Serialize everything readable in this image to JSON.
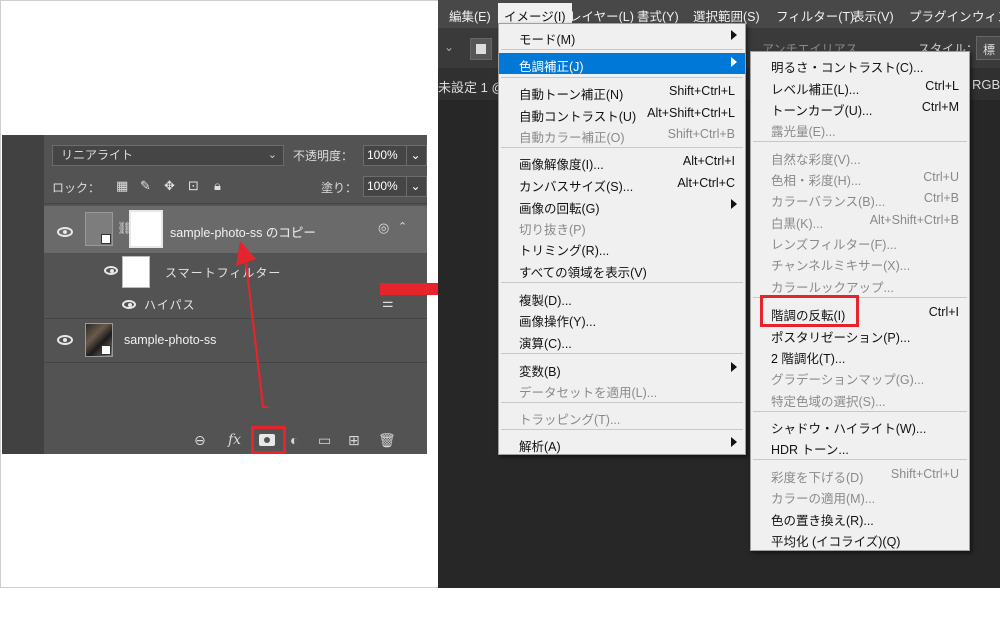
{
  "layers_panel": {
    "blend_mode": "リニアライト",
    "opacity_label": "不透明度：",
    "opacity_value": "100%",
    "lock_label": "ロック：",
    "fill_label": "塗り：",
    "fill_value": "100%",
    "layers": [
      {
        "name": "sample-photo-ss のコピー"
      },
      {
        "name": "スマートフィルター"
      },
      {
        "name": "ハイパス"
      },
      {
        "name": "sample-photo-ss"
      }
    ],
    "bottom_icons": {
      "fx": "fx"
    }
  },
  "menubar": [
    "編集(E)",
    "イメージ(I)",
    "レイヤー(L)",
    "書式(Y)",
    "選択範囲(S)",
    "フィルター(T)",
    "表示(V)",
    "プラグイン",
    "ウィン"
  ],
  "options_bar": {
    "anti_alias": "アンチエイリアス",
    "style": "スタイル：",
    "style_value": "標"
  },
  "doc_tab": "未設定 1 @",
  "doc_tab_right": "RGB/",
  "image_menu": [
    {
      "label": "モード(M)",
      "shortcut": ""
    },
    {
      "label": "色調補正(J)",
      "shortcut": ""
    },
    {
      "label": "自動トーン補正(N)",
      "shortcut": "Shift+Ctrl+L"
    },
    {
      "label": "自動コントラスト(U)",
      "shortcut": "Alt+Shift+Ctrl+L"
    },
    {
      "label": "自動カラー補正(O)",
      "shortcut": "Shift+Ctrl+B"
    },
    {
      "label": "画像解像度(I)...",
      "shortcut": "Alt+Ctrl+I"
    },
    {
      "label": "カンバスサイズ(S)...",
      "shortcut": "Alt+Ctrl+C"
    },
    {
      "label": "画像の回転(G)",
      "shortcut": ""
    },
    {
      "label": "切り抜き(P)",
      "shortcut": ""
    },
    {
      "label": "トリミング(R)...",
      "shortcut": ""
    },
    {
      "label": "すべての領域を表示(V)",
      "shortcut": ""
    },
    {
      "label": "複製(D)...",
      "shortcut": ""
    },
    {
      "label": "画像操作(Y)...",
      "shortcut": ""
    },
    {
      "label": "演算(C)...",
      "shortcut": ""
    },
    {
      "label": "変数(B)",
      "shortcut": ""
    },
    {
      "label": "データセットを適用(L)...",
      "shortcut": ""
    },
    {
      "label": "トラッピング(T)...",
      "shortcut": ""
    },
    {
      "label": "解析(A)",
      "shortcut": ""
    }
  ],
  "adjust_menu": [
    {
      "label": "明るさ・コントラスト(C)...",
      "shortcut": ""
    },
    {
      "label": "レベル補正(L)...",
      "shortcut": "Ctrl+L"
    },
    {
      "label": "トーンカーブ(U)...",
      "shortcut": "Ctrl+M"
    },
    {
      "label": "露光量(E)...",
      "shortcut": ""
    },
    {
      "label": "自然な彩度(V)...",
      "shortcut": ""
    },
    {
      "label": "色相・彩度(H)...",
      "shortcut": "Ctrl+U"
    },
    {
      "label": "カラーバランス(B)...",
      "shortcut": "Ctrl+B"
    },
    {
      "label": "白黒(K)...",
      "shortcut": "Alt+Shift+Ctrl+B"
    },
    {
      "label": "レンズフィルター(F)...",
      "shortcut": ""
    },
    {
      "label": "チャンネルミキサー(X)...",
      "shortcut": ""
    },
    {
      "label": "カラールックアップ...",
      "shortcut": ""
    },
    {
      "label": "階調の反転(I)",
      "shortcut": "Ctrl+I"
    },
    {
      "label": "ポスタリゼーション(P)...",
      "shortcut": ""
    },
    {
      "label": "2 階調化(T)...",
      "shortcut": ""
    },
    {
      "label": "グラデーションマップ(G)...",
      "shortcut": ""
    },
    {
      "label": "特定色域の選択(S)...",
      "shortcut": ""
    },
    {
      "label": "シャドウ・ハイライト(W)...",
      "shortcut": ""
    },
    {
      "label": "HDR トーン...",
      "shortcut": ""
    },
    {
      "label": "彩度を下げる(D)",
      "shortcut": "Shift+Ctrl+U"
    },
    {
      "label": "カラーの適用(M)...",
      "shortcut": ""
    },
    {
      "label": "色の置き換え(R)...",
      "shortcut": ""
    },
    {
      "label": "平均化 (イコライズ)(Q)",
      "shortcut": ""
    }
  ],
  "colors": {
    "accent_red": "#e5242b",
    "highlight_blue": "#0078d7"
  }
}
